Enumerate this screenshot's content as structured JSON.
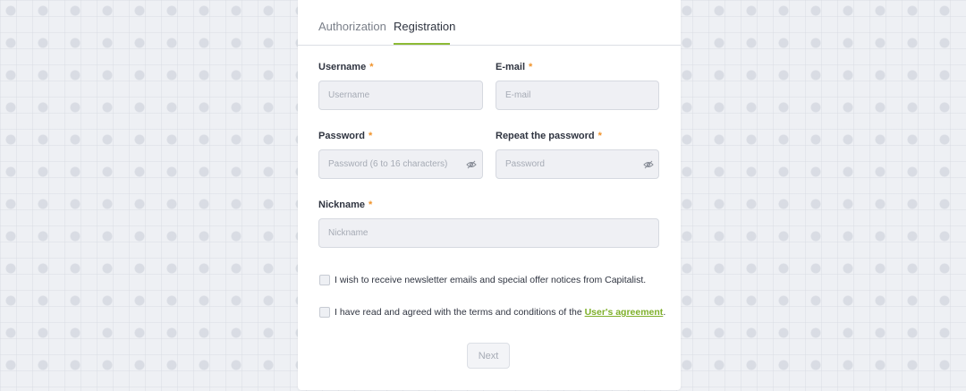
{
  "tabs": {
    "authorization": "Authorization",
    "registration": "Registration"
  },
  "form": {
    "username": {
      "label": "Username",
      "placeholder": "Username"
    },
    "email": {
      "label": "E-mail",
      "placeholder": "E-mail"
    },
    "password": {
      "label": "Password",
      "placeholder": "Password (6 to 16 characters)"
    },
    "repeat_password": {
      "label": "Repeat the password",
      "placeholder": "Password"
    },
    "nickname": {
      "label": "Nickname",
      "placeholder": "Nickname"
    },
    "required_marker": "*"
  },
  "checkboxes": {
    "newsletter": "I wish to receive newsletter emails and special offer notices from Capitalist.",
    "terms_prefix": "I have read and agreed with the terms and conditions of the ",
    "terms_link": "User's agreement",
    "terms_suffix": "."
  },
  "next_button": "Next",
  "colors": {
    "accent": "#8dba35",
    "required": "#f0932b",
    "link": "#7fb02b"
  },
  "icons": {
    "password_toggle": "eye-slash-icon"
  }
}
